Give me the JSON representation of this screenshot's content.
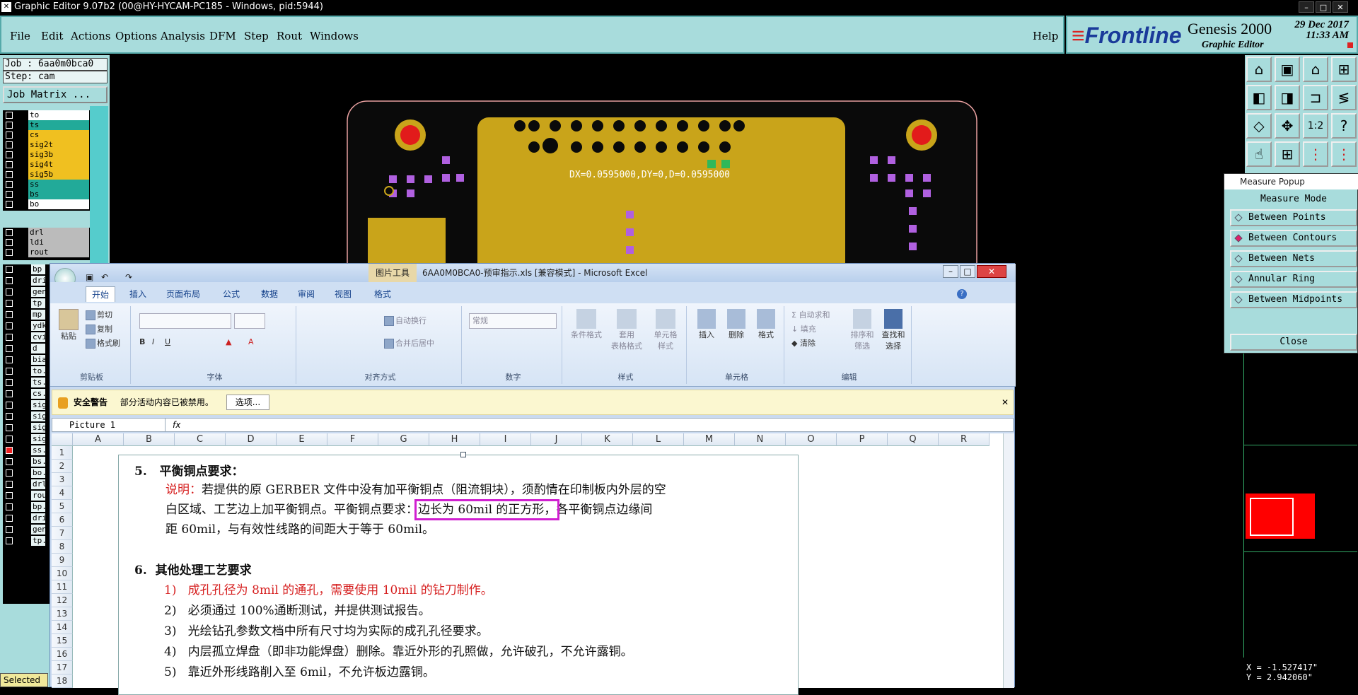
{
  "window": {
    "title": "Graphic Editor 9.07b2 (00@HY-HYCAM-PC185 - Windows, pid:5944)"
  },
  "menu": {
    "items": [
      "File",
      "Edit",
      "Actions",
      "Options",
      "Analysis",
      "DFM",
      "Step",
      "Rout",
      "Windows"
    ],
    "help": "Help"
  },
  "brand": {
    "logo": "Frontline",
    "product": "Genesis 2000",
    "subtitle": "Graphic Editor",
    "date": "29 Dec 2017",
    "time": "11:33 AM"
  },
  "job": {
    "job_label": "Job : 6aa0m0bca0",
    "step_label": "Step: cam",
    "matrix_button": "Job Matrix ..."
  },
  "layers_top": [
    {
      "name": "to",
      "color": "#ffffff"
    },
    {
      "name": "ts",
      "color": "#22aa99"
    },
    {
      "name": "cs",
      "color": "#f0c020"
    },
    {
      "name": "sig2t",
      "color": "#f0c020"
    },
    {
      "name": "sig3b",
      "color": "#f0c020"
    },
    {
      "name": "sig4t",
      "color": "#f0c020"
    },
    {
      "name": "sig5b",
      "color": "#f0c020"
    },
    {
      "name": "ss",
      "color": "#22aa99"
    },
    {
      "name": "bs",
      "color": "#22aa99"
    },
    {
      "name": "bo",
      "color": "#ffffff"
    }
  ],
  "layers_mid": [
    {
      "name": "drl",
      "color": "#bbbbbb"
    },
    {
      "name": "ldi",
      "color": "#bbbbbb"
    },
    {
      "name": "rout",
      "color": "#bbbbbb"
    }
  ],
  "layers_bottom": [
    "bp",
    "dri",
    "gen",
    "tp",
    "mp",
    "ydk",
    "cvi",
    "d",
    "bia",
    "to.",
    "ts.",
    "cs.",
    "sig",
    "sig",
    "sig",
    "sig",
    "ss.",
    "bs.",
    "bo.",
    "drl",
    "rou",
    "bp.",
    "dri",
    "gen",
    "tp."
  ],
  "status": {
    "selected": "Selected"
  },
  "pcb": {
    "measure_text": "DX=0.0595000,DY=0,D=0.0595000"
  },
  "measure": {
    "title": "Measure Popup",
    "mode_label": "Measure Mode",
    "options": [
      "Between Points",
      "Between Contours",
      "Between Nets",
      "Annular Ring",
      "Between Midpoints"
    ],
    "selected_option": "Between Contours",
    "close": "Close"
  },
  "coords": {
    "x": "X = -1.527417\"",
    "y": "Y = 2.942060\""
  },
  "excel": {
    "title": "6AA0M0BCA0-预审指示.xls [兼容模式] - Microsoft Excel",
    "context_tab": "图片工具",
    "tabs": [
      "开始",
      "插入",
      "页面布局",
      "公式",
      "数据",
      "审阅",
      "视图",
      "格式"
    ],
    "groups": [
      "剪贴板",
      "字体",
      "对齐方式",
      "数字",
      "样式",
      "单元格",
      "编辑"
    ],
    "clipboard": {
      "paste": "粘贴",
      "cut": "剪切",
      "copy": "复制",
      "format_painter": "格式刷"
    },
    "alignment": {
      "wrap": "自动换行",
      "merge": "合并后居中"
    },
    "number": {
      "format": "常规"
    },
    "styles": {
      "conditional": "条件格式",
      "table": "套用\n表格格式",
      "cell": "单元格\n样式"
    },
    "cells": {
      "insert": "插入",
      "delete": "删除",
      "format": "格式"
    },
    "editing": {
      "autosum": "自动求和",
      "fill": "填充",
      "clear": "清除",
      "sort": "排序和\n筛选",
      "find": "查找和\n选择"
    },
    "security": {
      "title": "安全警告",
      "message": "部分活动内容已被禁用。",
      "options": "选项..."
    },
    "name_box": "Picture 1",
    "columns": [
      "A",
      "B",
      "C",
      "D",
      "E",
      "F",
      "G",
      "H",
      "I",
      "J",
      "K",
      "L",
      "M",
      "N",
      "O",
      "P",
      "Q",
      "R"
    ],
    "rows": [
      "1",
      "2",
      "3",
      "4",
      "5",
      "6",
      "7",
      "8",
      "9",
      "10",
      "11",
      "12",
      "13",
      "14",
      "15",
      "16",
      "17",
      "18"
    ],
    "doc": {
      "s5_num": "5.",
      "s5_title": "平衡铜点要求：",
      "s5_label": "说明：",
      "s5_l1": "若提供的原 GERBER 文件中没有加平衡铜点（阻流铜块），须酌情在印制板内外层的空",
      "s5_l2a": "白区域、工艺边上加平衡铜点。平衡铜点要求：",
      "s5_l2b": "边长为 60mil 的正方形，",
      "s5_l2c": "各平衡铜点边缘间",
      "s5_l3": "距 60mil，与有效性线路的间距大于等于 60mil。",
      "s6_num": "6.",
      "s6_title": "其他处理工艺要求",
      "items": [
        {
          "n": "1)",
          "t": "成孔孔径为 8mil 的通孔，需要使用 10mil 的钻刀制作。",
          "red": true
        },
        {
          "n": "2)",
          "t": "必须通过 100%通断测试，并提供测试报告。",
          "red": false
        },
        {
          "n": "3)",
          "t": "光绘钻孔参数文档中所有尺寸均为实际的成孔孔径要求。",
          "red": false
        },
        {
          "n": "4)",
          "t": "内层孤立焊盘（即非功能焊盘）删除。靠近外形的孔照做，允许破孔，不允许露铜。",
          "red": false
        },
        {
          "n": "5)",
          "t": "靠近外形线路削入至 6mil，不允许板边露铜。",
          "red": false
        }
      ]
    }
  }
}
